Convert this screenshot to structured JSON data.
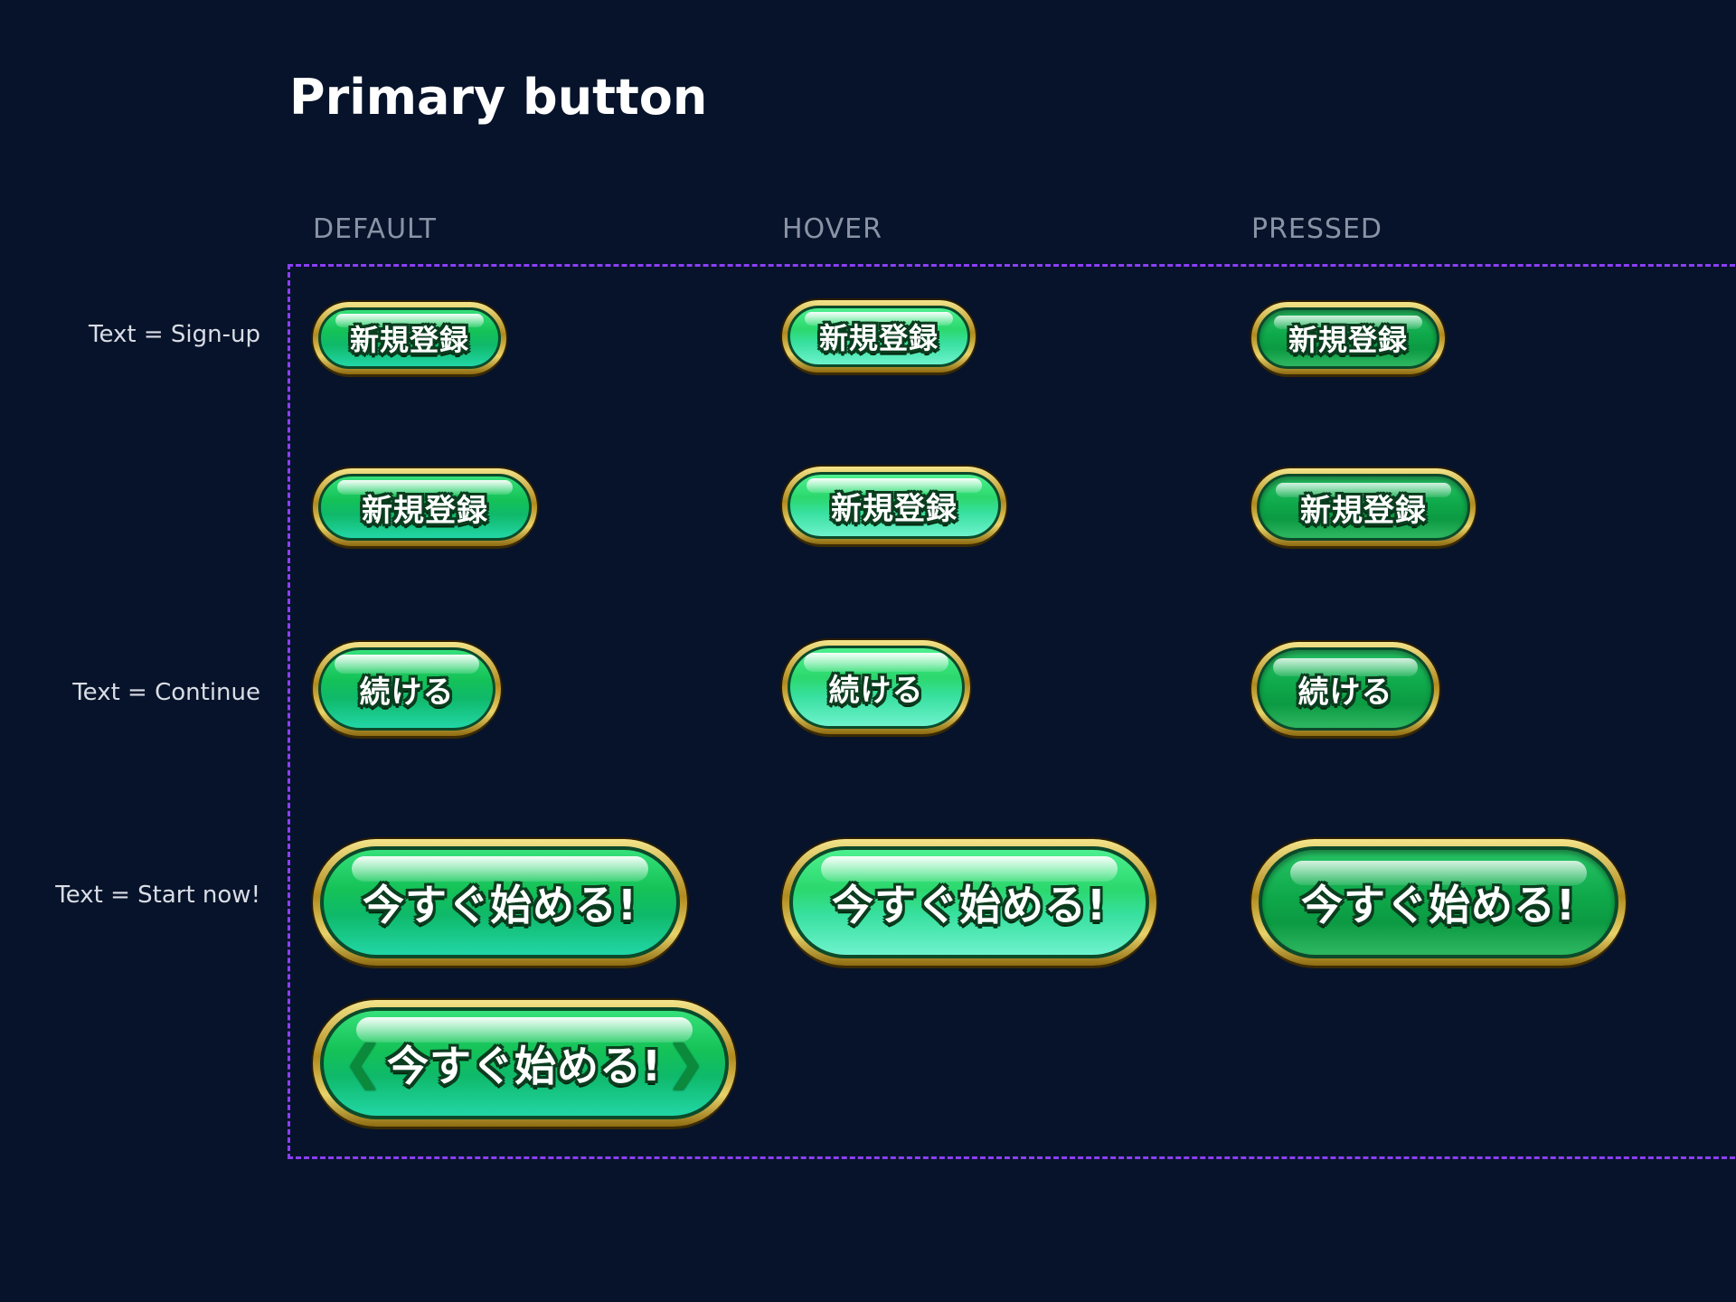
{
  "page": {
    "title": "Primary button"
  },
  "columns": [
    "DEFAULT",
    "HOVER",
    "PRESSED"
  ],
  "rows": {
    "signup": "Text = Sign-up",
    "continue": "Text = Continue",
    "start_now": "Text = Start now!"
  },
  "buttons": {
    "signup": "新規登録",
    "continue": "続ける",
    "start_now": "今すぐ始める!"
  },
  "icons": {
    "left_arrow": "❮",
    "right_arrow": "❯"
  },
  "colors": {
    "background": "#07132a",
    "frame_border": "#8a3ff5",
    "button_green": "#14c257",
    "button_gold_rim": "#d8b940",
    "text_outline": "#0b3d1f"
  }
}
